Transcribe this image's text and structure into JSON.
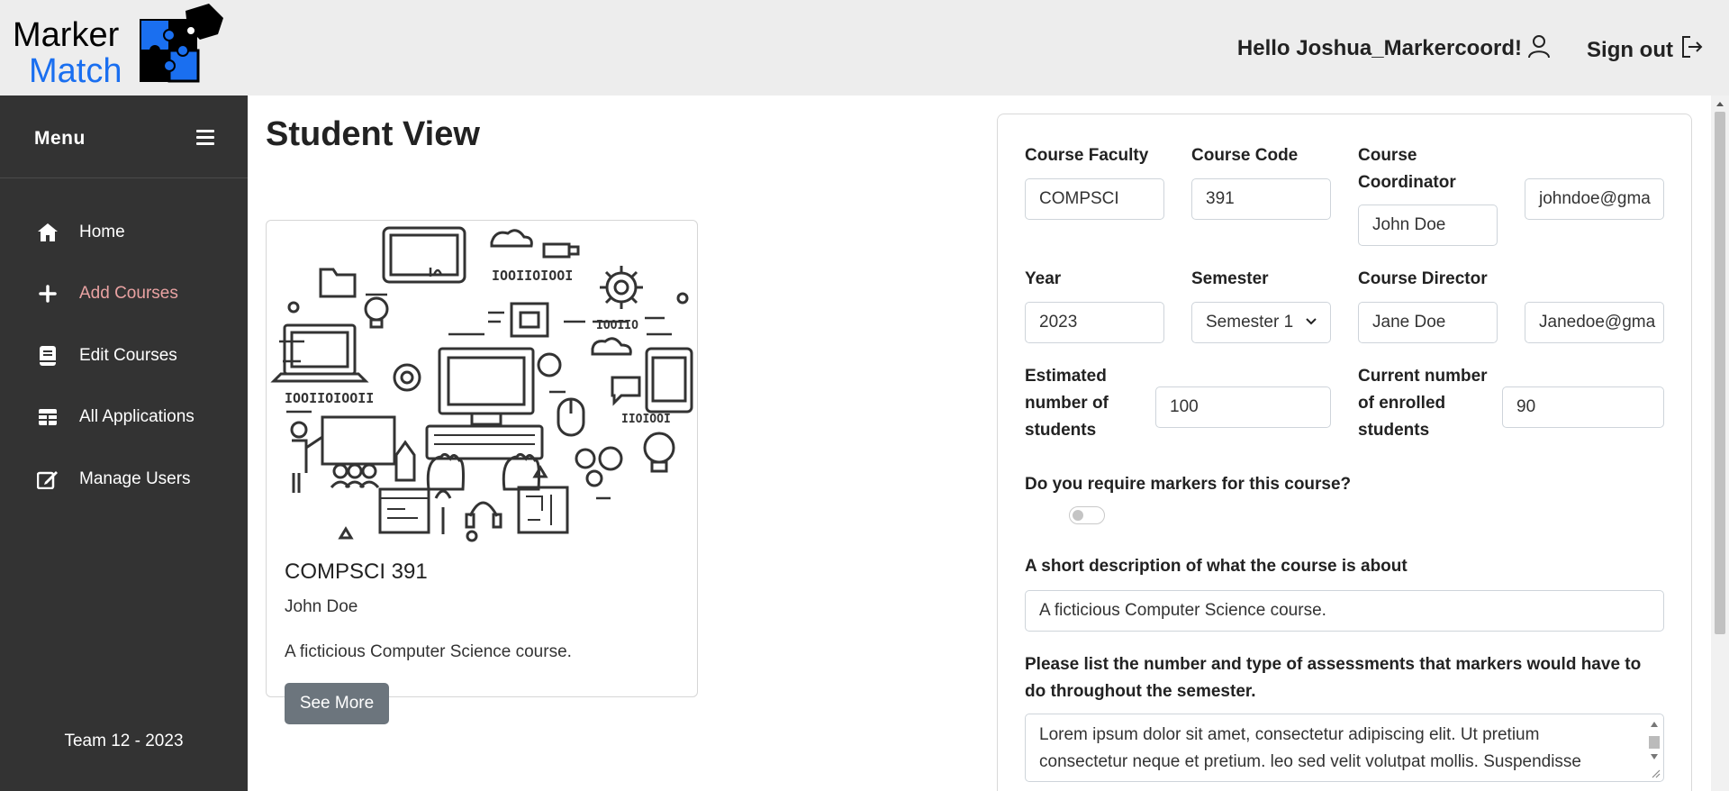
{
  "header": {
    "logo_line1": "Marker",
    "logo_line2": "Match",
    "greeting": "Hello Joshua_Markercoord!",
    "signout_label": "Sign out",
    "user_icon": "user-icon",
    "signout_icon": "sign-out-icon"
  },
  "sidebar": {
    "menu_title": "Menu",
    "items": [
      {
        "label": "Home",
        "icon": "home-icon",
        "active": false
      },
      {
        "label": "Add Courses",
        "icon": "plus-icon",
        "active": true
      },
      {
        "label": "Edit Courses",
        "icon": "book-icon",
        "active": false
      },
      {
        "label": "All Applications",
        "icon": "table-icon",
        "active": false
      },
      {
        "label": "Manage Users",
        "icon": "edit-icon",
        "active": false
      }
    ],
    "footer": "Team 12 - 2023",
    "active_color": "#e9a2a2"
  },
  "main": {
    "page_title": "Student View",
    "card": {
      "title": "COMPSCI 391",
      "coordinator": "John Doe",
      "description": "A ficticious Computer Science course.",
      "button_label": "See More"
    }
  },
  "form": {
    "faculty_label": "Course Faculty",
    "faculty_value": "COMPSCI",
    "code_label": "Course Code",
    "code_value": "391",
    "coordinator_label_1": "Course",
    "coordinator_label_2": "Coordinator",
    "coordinator_value": "John Doe",
    "coordinator_email": "johndoe@gma",
    "year_label": "Year",
    "year_value": "2023",
    "semester_label": "Semester",
    "semester_value": "Semester 1",
    "director_label": "Course Director",
    "director_value": "Jane Doe",
    "director_email": "Janedoe@gma",
    "estimated_label_1": "Estimated",
    "estimated_label_2": "number of",
    "estimated_label_3": "students",
    "estimated_value": "100",
    "enrolled_label_1": "Current number",
    "enrolled_label_2": "of enrolled",
    "enrolled_label_3": "students",
    "enrolled_value": "90",
    "markers_question": "Do you require markers for this course?",
    "markers_required": false,
    "description_label": "A short description of what the course is about",
    "description_value": "A ficticious Computer Science course.",
    "assessments_label_1": "Please list the number and type of assessments that markers would have to",
    "assessments_label_2": "do throughout the semester.",
    "assessments_line_1": "Lorem ipsum dolor sit amet, consectetur adipiscing elit. Ut pretium",
    "assessments_line_2": "consectetur neque et pretium. leo sed velit volutpat mollis. Suspendisse"
  }
}
